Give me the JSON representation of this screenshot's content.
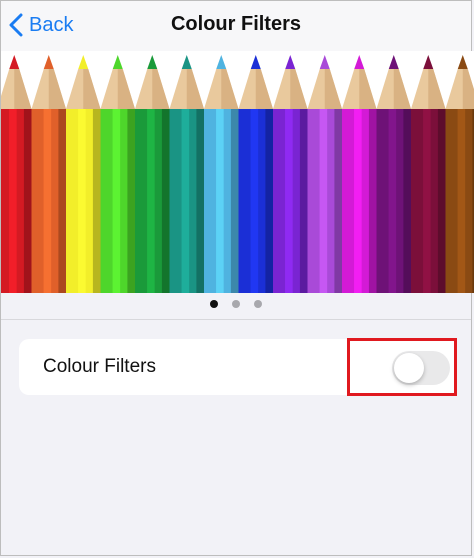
{
  "navbar": {
    "back_label": "Back",
    "title": "Colour Filters",
    "accent_color": "#1a7cf2"
  },
  "carousel": {
    "page_count": 3,
    "active_page": 1,
    "pencil_colors": [
      "#d41a23",
      "#e0602a",
      "#f2ee2a",
      "#4ed62b",
      "#1a9a3a",
      "#1a9484",
      "#4fb3e0",
      "#1b2fd6",
      "#7a24d2",
      "#a94ad8",
      "#d31ad6",
      "#6e1277",
      "#7b0f3a",
      "#8a4a13"
    ]
  },
  "settings": {
    "colour_filters_label": "Colour Filters",
    "colour_filters_enabled": false
  },
  "annotation": {
    "highlight_color": "#e0191f"
  }
}
